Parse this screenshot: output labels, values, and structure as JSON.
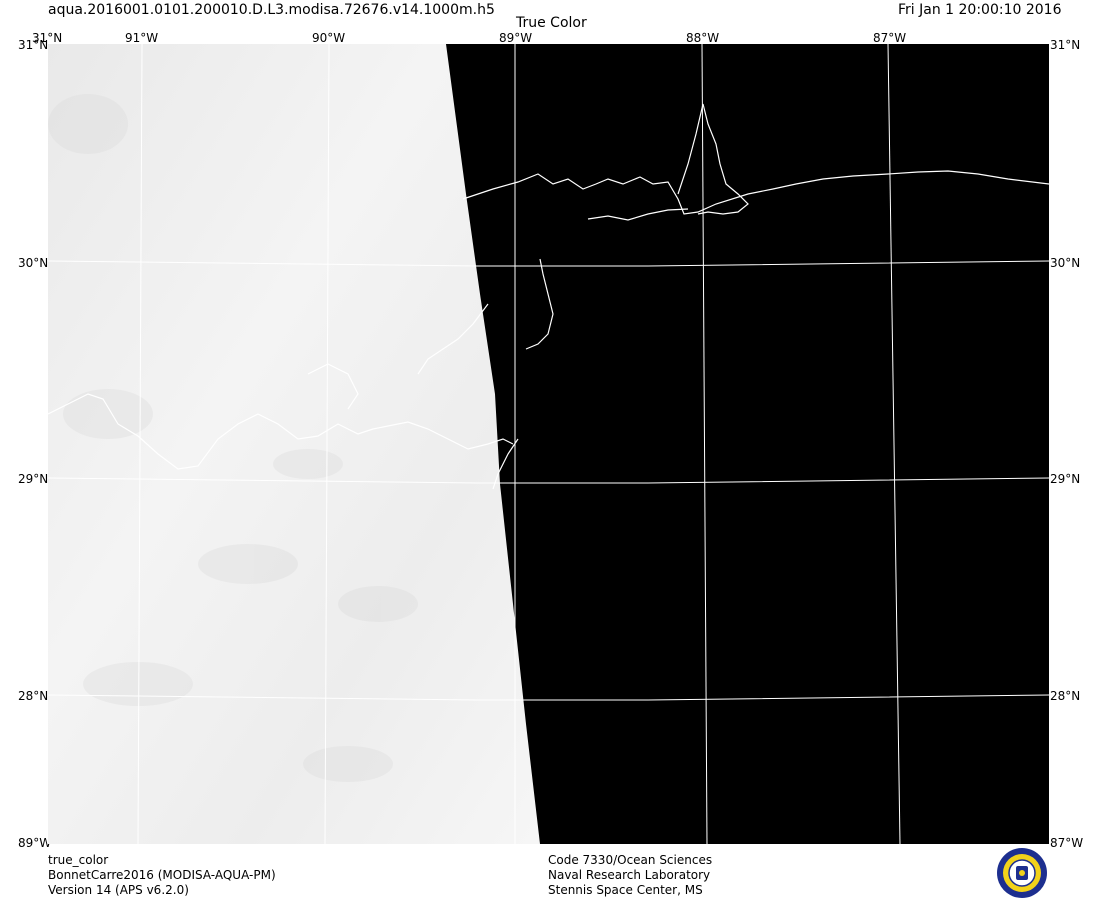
{
  "header": {
    "filename": "aqua.2016001.0101.200010.D.L3.modisa.72676.v14.1000m.h5",
    "product_title": "True Color",
    "datetime": "Fri Jan  1 20:00:10 2016"
  },
  "map": {
    "lon_labels": [
      "91°W",
      "90°W",
      "89°W",
      "88°W",
      "87°W"
    ],
    "corner_lon_label": "89°W",
    "lat_labels_left": [
      "31°N",
      "30°N",
      "29°N",
      "28°N"
    ],
    "lat_labels_right": [
      "31°N",
      "30°N",
      "29°N",
      "28°N"
    ],
    "colors": {
      "water_background": "#000000",
      "cloud": "#f2f2f2",
      "graticule": "#ffffff",
      "coastline": "#ffffff"
    }
  },
  "footer": {
    "left": [
      "true_color",
      "BonnetCarre2016 (MODISA-AQUA-PM)",
      "Version 14 (APS v6.2.0)"
    ],
    "center": [
      "Code 7330/Ocean Sciences",
      "Naval Research Laboratory",
      "Stennis Space Center, MS"
    ],
    "logo_icon": "nrl-seal-icon"
  }
}
